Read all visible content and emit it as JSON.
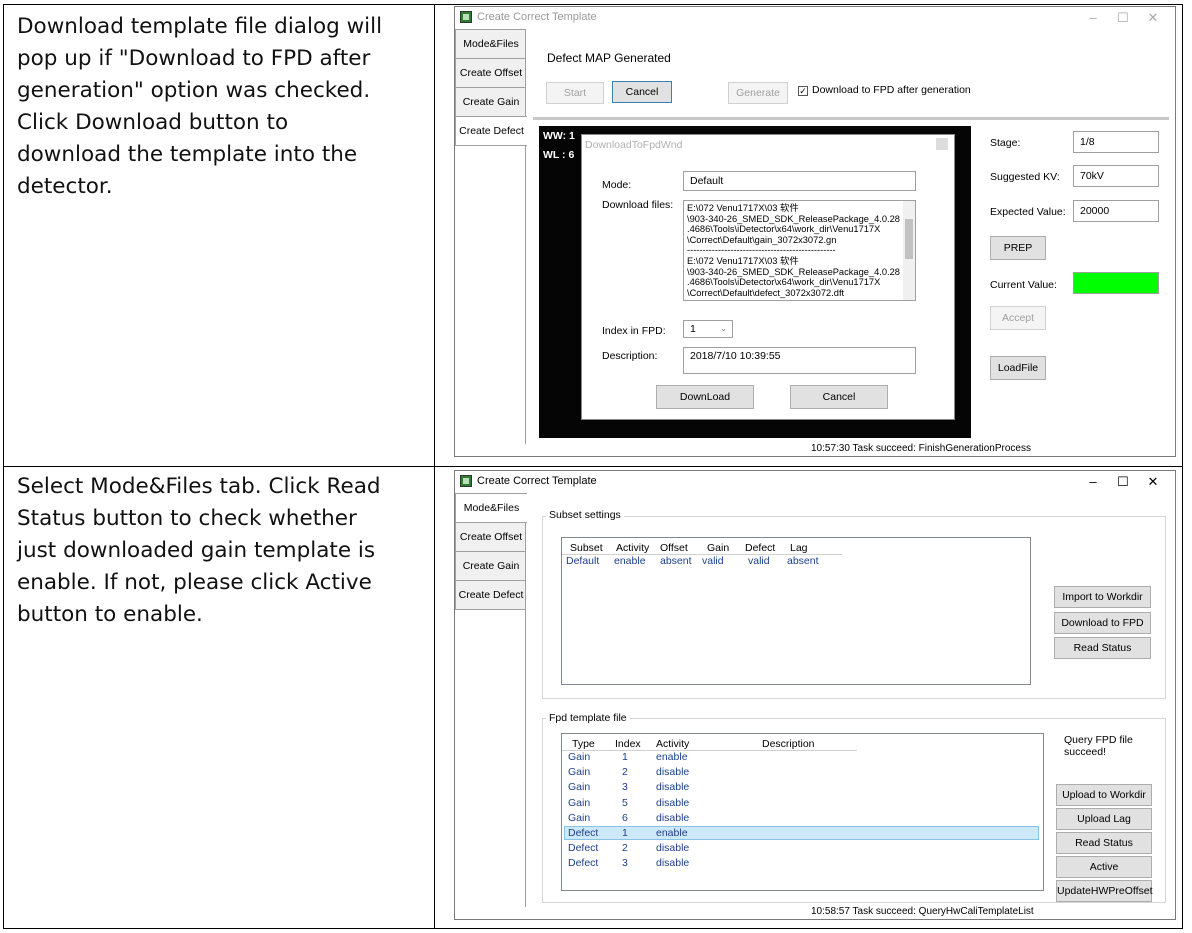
{
  "instructions": [
    {
      "lines": [
        "Download template file dialog will",
        "pop up if \"Download to FPD after",
        "generation\" option was checked.",
        "Click Download button to",
        "download the template into the",
        "detector."
      ]
    },
    {
      "lines": [
        "Select Mode&Files tab. Click Read",
        "Status button to check whether",
        "just downloaded gain template is",
        "enable. If not, please click Active",
        "button to enable."
      ]
    }
  ],
  "window": {
    "title": "Create Correct Template",
    "min": "–",
    "max": "☐",
    "close": "✕",
    "tabs": [
      "Mode&Files",
      "Create Offset",
      "Create Gain",
      "Create Defect"
    ]
  },
  "shot1": {
    "heading": "Defect MAP Generated",
    "start": "Start",
    "cancel": "Cancel",
    "generate": "Generate",
    "download_option": "Download to FPD after generation",
    "check": "✓",
    "ww": "WW: 1",
    "wl": "WL : 6",
    "stage_label": "Stage:",
    "stage_value": "1/8",
    "kv_label": "Suggested KV:",
    "kv_value": "70kV",
    "expected_label": "Expected Value:",
    "expected_value": "20000",
    "prep": "PREP",
    "current_label": "Current Value:",
    "current_color": "#00ff00",
    "accept": "Accept",
    "loadfile": "LoadFile",
    "status": "10:57:30 Task succeed: FinishGenerationProcess",
    "dialog": {
      "title": "DownloadToFpdWnd",
      "mode_label": "Mode:",
      "mode_value": "Default",
      "files_label": "Download files:",
      "files_lines": [
        "E:\\072 Venu1717X\\03 软件",
        "\\903-340-26_SMED_SDK_ReleasePackage_4.0.28",
        ".4686\\Tools\\iDetector\\x64\\work_dir\\Venu1717X",
        "\\Correct\\Default\\gain_3072x3072.gn",
        "------------------------------------------------",
        "E:\\072 Venu1717X\\03 软件",
        "\\903-340-26_SMED_SDK_ReleasePackage_4.0.28",
        ".4686\\Tools\\iDetector\\x64\\work_dir\\Venu1717X",
        "\\Correct\\Default\\defect_3072x3072.dft"
      ],
      "index_label": "Index in FPD:",
      "index_value": "1",
      "desc_label": "Description:",
      "desc_value": "2018/7/10 10:39:55",
      "download_btn": "DownLoad",
      "cancel_btn": "Cancel"
    }
  },
  "shot2": {
    "subset_group": "Subset settings",
    "subset_cols": [
      "Subset",
      "Activity",
      "Offset",
      "Gain",
      "Defect",
      "Lag"
    ],
    "subset_row": [
      "Default",
      "enable",
      "absent",
      "valid",
      "valid",
      "absent"
    ],
    "import": "Import to Workdir",
    "download": "Download to FPD",
    "read_status": "Read Status",
    "fpd_group": "Fpd template file",
    "fpd_cols": [
      "Type",
      "Index",
      "Activity",
      "Description"
    ],
    "fpd_rows": [
      [
        "Gain",
        "1",
        "enable"
      ],
      [
        "Gain",
        "2",
        "disable"
      ],
      [
        "Gain",
        "3",
        "disable"
      ],
      [
        "Gain",
        "5",
        "disable"
      ],
      [
        "Gain",
        "6",
        "disable"
      ],
      [
        "Defect",
        "1",
        "enable"
      ],
      [
        "Defect",
        "2",
        "disable"
      ],
      [
        "Defect",
        "3",
        "disable"
      ]
    ],
    "selected_row": 5,
    "query_msg_1": "Query FPD file",
    "query_msg_2": "succeed!",
    "upload": "Upload to Workdir",
    "upload_lag": "Upload Lag",
    "read_status2": "Read Status",
    "active": "Active",
    "update": "UpdateHWPreOffset",
    "status": "10:58:57 Task succeed: QueryHwCaliTemplateList"
  }
}
